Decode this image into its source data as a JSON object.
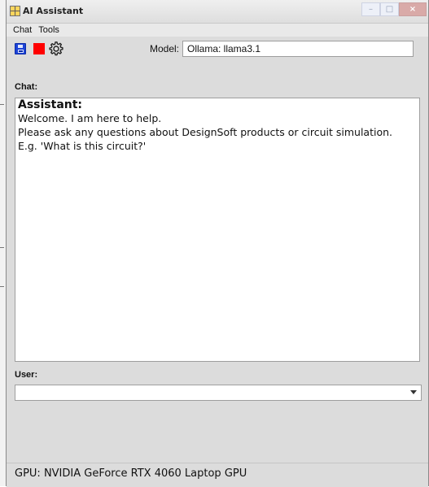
{
  "window": {
    "title": "AI Assistant",
    "controls": {
      "minimize": "–",
      "maximize": "□",
      "close": "×"
    }
  },
  "menu": {
    "items": [
      "Chat",
      "Tools"
    ]
  },
  "toolbar": {
    "model_label": "Model:",
    "model_value": "Ollama: llama3.1"
  },
  "chat": {
    "label": "Chat:",
    "assistant_name": "Assistant:",
    "lines": [
      "Welcome. I am here to help.",
      "Please ask any questions about DesignSoft products or circuit simulation.",
      "E.g. 'What is this circuit?'"
    ]
  },
  "user": {
    "label": "User:",
    "value": ""
  },
  "status": {
    "gpu": "GPU: NVIDIA GeForce RTX 4060 Laptop GPU"
  },
  "icons": [
    "app-icon",
    "save-icon",
    "stop-icon",
    "gear-icon",
    "dropdown-arrow-icon"
  ],
  "colors": {
    "save_blue": "#1c43d6",
    "stop_red": "#ff0000",
    "window_gray": "#dcdcdc"
  }
}
